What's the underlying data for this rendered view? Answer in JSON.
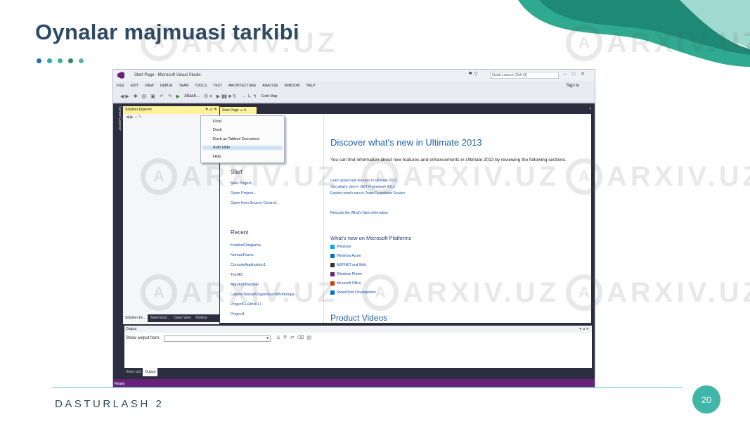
{
  "slide": {
    "title": "Oynalar majmuasi tarkibi",
    "footer": "DASTURLASH 2",
    "page_number": "20",
    "watermark": "ARXIV.UZ",
    "dot_colors": [
      "#2b6cb0",
      "#2aa6c4",
      "#3bb39a",
      "#2e8a5e",
      "#5bb5a8"
    ]
  },
  "vs": {
    "window_title": "Start Page - Microsoft Visual Studio",
    "quick_launch": "Quick Launch (Ctrl+Q)",
    "menu": [
      "FILE",
      "EDIT",
      "VIEW",
      "DEBUG",
      "TEAM",
      "TOOLS",
      "TEST",
      "ARCHITECTURE",
      "ANALYZE",
      "WINDOW",
      "HELP"
    ],
    "sign_in": "Sign in",
    "toolbar": {
      "attach": "Attach...",
      "code_map": "Code Map"
    },
    "side_tab": "Server Explorer",
    "solution_explorer": {
      "title": "Solution Explorer",
      "tabs": [
        "Solution Ex...",
        "Team Expl...",
        "Class View",
        "Toolbox"
      ]
    },
    "doc_tab": "Start Page",
    "context_menu": [
      "Float",
      "Dock",
      "Dock as Tabbed Document",
      "Auto Hide",
      "Hide"
    ],
    "start_page": {
      "start_heading": "Start",
      "start_links": [
        "New Project...",
        "Open Project...",
        "Open from Source Control..."
      ],
      "recent_heading": "Recent",
      "recent_links": [
        "KvadratTenglama",
        "NomanFazos",
        "ConsoleApplication1",
        "Test4i0",
        "RandomNumber",
        "LabelniTeskariUzgartiruvchiButtonqar...",
        "ProjectCLRforDLl",
        "Project1"
      ],
      "discover": "Discover what's new in Ultimate 2013",
      "description": "You can find information about new features and enhancements in Ultimate 2013 by reviewing the following sections.",
      "learn_links": [
        "Learn about new features in Ultimate 2013",
        "See what's new in .NET Framework 4.5.1",
        "Explore what's new in Team Foundation Service"
      ],
      "relocate": "Relocate the What's New information",
      "platform_heading": "What's new on Microsoft Platforms",
      "platforms": [
        "Windows",
        "Windows Azure",
        "ASP.NET and Web",
        "Windows Phone",
        "Microsoft Office",
        "SharePoint Development"
      ],
      "platform_colors": [
        "#00a4ef",
        "#0072c6",
        "#333333",
        "#68217a",
        "#d83b01",
        "#0072c6"
      ],
      "product_videos": "Product Videos"
    },
    "output": {
      "title": "Output",
      "show_from": "Show output from:",
      "tabs": [
        "Error List",
        "Output"
      ]
    },
    "status": "Ready",
    "accent": "#68217a"
  }
}
